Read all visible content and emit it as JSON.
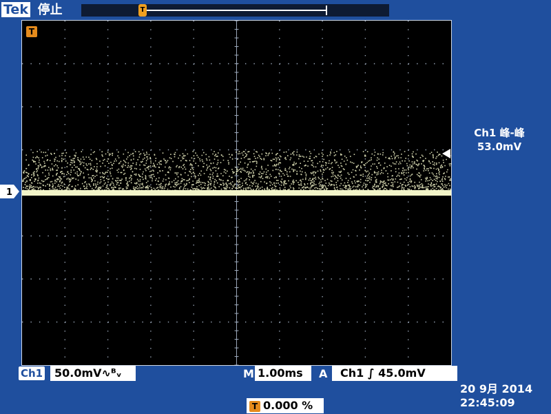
{
  "header": {
    "brand": "Tek",
    "status": "停止",
    "trigger_marker": "T"
  },
  "screen": {
    "trigger_level_marker": "T",
    "channel_marker": "1"
  },
  "measurement": {
    "label": "Ch1 峰-峰",
    "value": "53.0mV"
  },
  "footer": {
    "channel": "Ch1",
    "scale": "50.0mV∿ᴮᵥ",
    "timebase_prefix": "M",
    "timebase": "1.00ms",
    "trigger_prefix": "A",
    "trigger": "Ch1  ∫  45.0mV",
    "position_marker": "T",
    "position": "0.000 %",
    "date": "20 9月  2014",
    "time": "22:45:09"
  },
  "colors": {
    "background": "#1f4f9e",
    "trace": "#f2f4c8",
    "grid": "#9aa6b8",
    "marker": "#e58b1c"
  }
}
